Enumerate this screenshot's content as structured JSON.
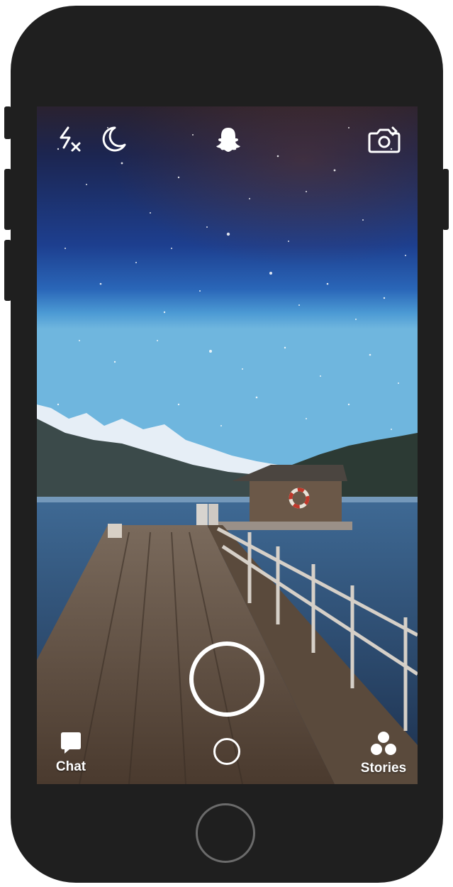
{
  "device": {
    "frame_color": "#1f1f1f",
    "home_button": "home-button"
  },
  "camera": {
    "top_bar": {
      "flash_toggle": "flash-off-icon",
      "night_mode_toggle": "moon-icon",
      "profile": "ghost-icon",
      "flip_camera": "flip-camera-icon"
    },
    "shutter": "shutter-button",
    "memories": "memories-button"
  },
  "bottom_nav": {
    "chat_label": "Chat",
    "chat_icon": "chat-bubble-icon",
    "stories_label": "Stories",
    "stories_icon": "stories-icon"
  },
  "colors": {
    "ui_foreground": "#ffffff",
    "sky_top": "#1b2b55",
    "sky_mid": "#1e4a9a",
    "horizon": "#3f8fd0",
    "dock": "#6a5646"
  }
}
